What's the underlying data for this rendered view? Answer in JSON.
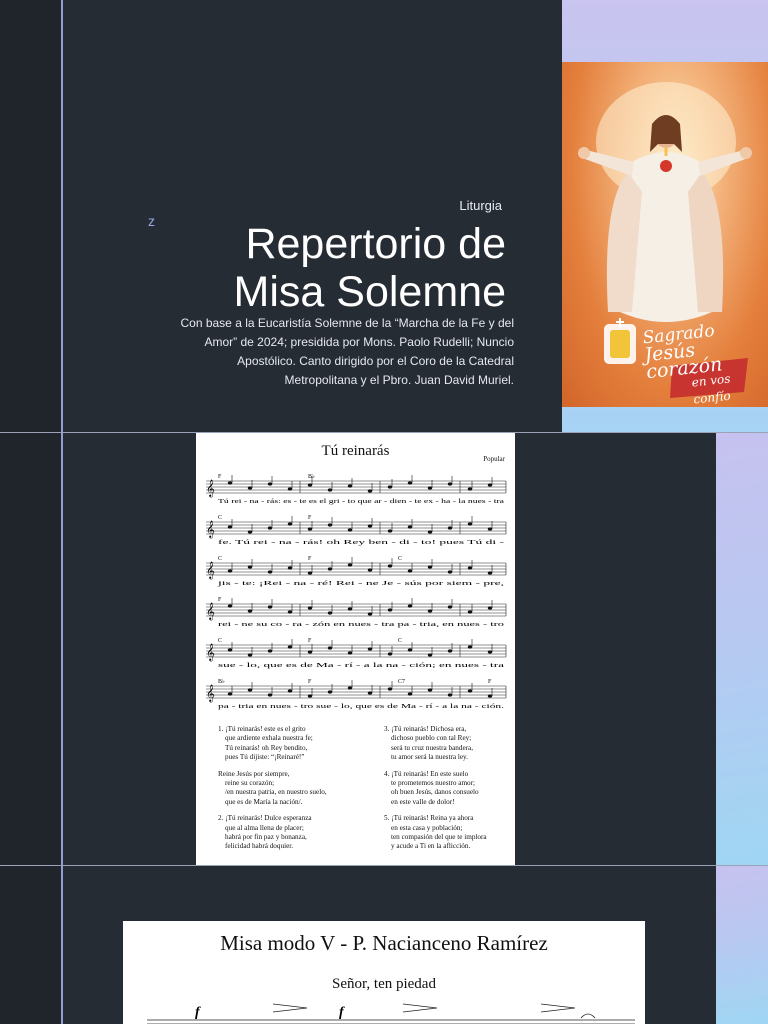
{
  "slide1": {
    "marker": "z",
    "kicker": "Liturgia",
    "title_line1": "Repertorio de",
    "title_line2": "Misa Solemne",
    "subtitle": "Con base a la Eucaristía Solemne de la “Marcha de la Fe y del Amor” de 2024; presidida por Mons. Paolo Rudelli; Nuncio Apostólico. Canto dirigido por el Coro de la Catedral Metropolitana y el Pbro. Juan David Muriel.",
    "image_text": {
      "line1": "Sagrado",
      "line2": "Jesús corazón",
      "line3": "en vos confío"
    }
  },
  "slide2": {
    "sheet_title": "Tú reinarás",
    "credit": "Popular",
    "staves": [
      {
        "chords": [
          "F",
          "B♭"
        ],
        "lyrics": "Tú rei - na - rás: es - te es el gri - to que ar - dien - te ex - ha - la nues - tra"
      },
      {
        "chords": [
          "C",
          "F"
        ],
        "lyrics": "fe. Tú rei - na - rás! oh Rey ben - di - to! pues Tú di -"
      },
      {
        "chords": [
          "C",
          "F",
          "C"
        ],
        "lyrics": "jis - te: ¡Rei - na - ré! Rei - ne Je - sús por siem - pre,"
      },
      {
        "chords": [
          "F"
        ],
        "lyrics": "rei - ne su co - ra - zón en nues - tra pa - tria, en nues - tro"
      },
      {
        "chords": [
          "C",
          "F",
          "C"
        ],
        "lyrics": "sue - lo, que es de Ma - rí - a la na - ción; en nues - tra"
      },
      {
        "chords": [
          "B♭",
          "F",
          "C7",
          "F"
        ],
        "lyrics": "pa - tria en nues - tro sue - lo, que es de Ma - rí - a la na - ción."
      }
    ],
    "verses_left": [
      [
        "1. ¡Tú reinarás! este es el grito",
        "que ardiente exhala nuestra fe;",
        "Tú reinarás! oh Rey bendito,",
        "pues Tú dijiste: “¡Reinaré!”"
      ],
      [
        "Reine Jesús por siempre,",
        "reine su corazón;",
        "/en nuestra patria, en nuestro suelo,",
        "que es de María la nación/."
      ],
      [
        "2. ¡Tú reinarás! Dulce esperanza",
        "que al alma llena de placer;",
        "habrá por fin paz y bonanza,",
        "felicidad habrá doquier."
      ]
    ],
    "verses_right": [
      [
        "3. ¡Tú reinarás! Dichosa era,",
        "dichoso pueblo con tal Rey;",
        "será tu cruz nuestra bandera,",
        "tu amor será la nuestra ley."
      ],
      [
        "4. ¡Tú reinarás! En este suelo",
        "te prometemos nuestro amor;",
        "oh buen Jesús, danos consuelo",
        "en este valle de dolor!"
      ],
      [
        "5. ¡Tú reinarás! Reina ya ahora",
        "en esta casa y población;",
        "ten compasión del que te implora",
        "y acude a Ti en la aflicción."
      ]
    ]
  },
  "slide3": {
    "sheet_title": "Misa modo V - P. Nacianceno Ramírez",
    "sheet_subtitle": "Señor, ten piedad"
  },
  "colors": {
    "slide_bg": "#262c34",
    "accent_line": "#8e9fd8",
    "title_text": "#ffffff"
  }
}
